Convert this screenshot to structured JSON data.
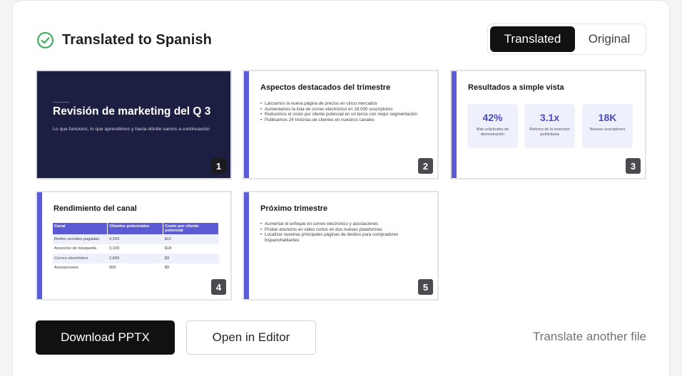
{
  "header": {
    "title": "Translated to Spanish",
    "status_icon": "check-circle-icon",
    "accent": "#3daa5b"
  },
  "toggle": {
    "active": "Translated",
    "inactive": "Original"
  },
  "slides": {
    "s1": {
      "number": "1",
      "title": "Revisión de marketing del Q 3",
      "subtitle": "Lo que funcionó, lo que aprendimos y hacia dónde vamos a continuación"
    },
    "s2": {
      "number": "2",
      "title": "Aspectos destacados del trimestre",
      "bullets": [
        "Lanzamos la nueva página de precios en cinco mercados",
        "Aumentamos la lista de correo electrónico en 18,000 suscriptores",
        "Reducimos el costo por cliente potencial en un tercio con mejor segmentación",
        "Publicamos 24 historias de clientes en nuestros canales"
      ]
    },
    "s3": {
      "number": "3",
      "title": "Resultados a simple vista",
      "stats": [
        {
          "value": "42%",
          "label": "Más solicitudes de demostración"
        },
        {
          "value": "3.1x",
          "label": "Retorno de la inversión publicitaria"
        },
        {
          "value": "18K",
          "label": "Nuevos suscriptores"
        }
      ]
    },
    "s4": {
      "number": "4",
      "title": "Rendimiento del canal",
      "columns": [
        "Canal",
        "Clientes potenciales",
        "Costo por cliente potencial"
      ],
      "rows": [
        [
          "Redes sociales pagadas",
          "4,200",
          "$12"
        ],
        [
          "Anuncios de búsqueda",
          "3,100",
          "$18"
        ],
        [
          "Correo electrónico",
          "2,600",
          "$3"
        ],
        [
          "Asociaciones",
          "900",
          "$9"
        ]
      ]
    },
    "s5": {
      "number": "5",
      "title": "Próximo trimestre",
      "bullets": [
        "Aumentar el enfoque en correo electrónico y asociaciones",
        "Probar anuncios en video cortos en dos nuevas plataformas",
        "Localizar nuestras principales páginas de destino para compradores hispanohablantes"
      ]
    }
  },
  "actions": {
    "download": "Download PPTX",
    "editor": "Open in Editor",
    "another": "Translate another file"
  },
  "colors": {
    "primary": "#111111",
    "slide_accent": "#5b5bd6",
    "cover_bg": "#1d1f42"
  }
}
